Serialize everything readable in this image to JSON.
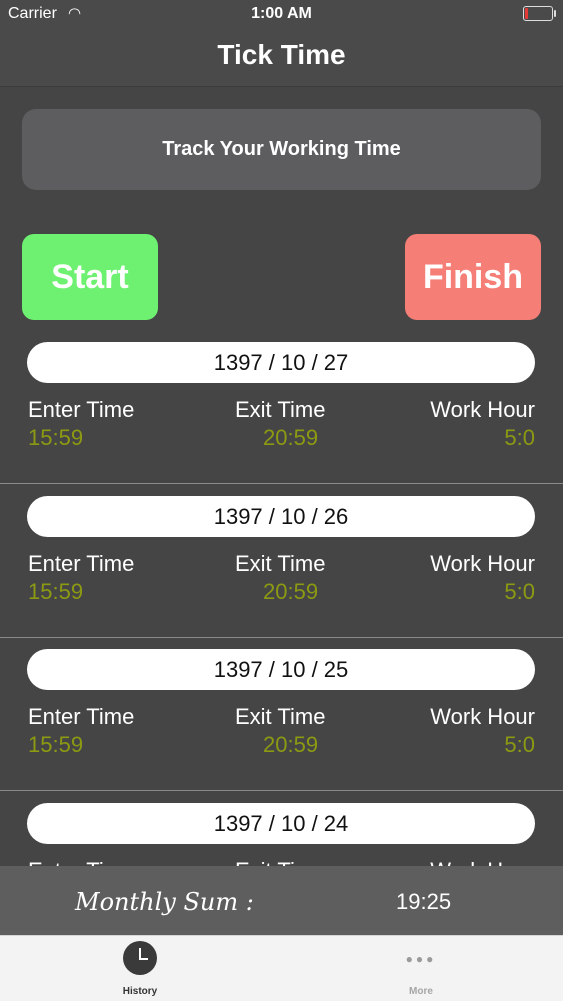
{
  "status_bar": {
    "carrier": "Carrier",
    "time": "1:00 AM",
    "battery_level": 0.12
  },
  "nav": {
    "title": "Tick Time"
  },
  "track_label": "Track Your Working Time",
  "actions": {
    "start_label": "Start",
    "finish_label": "Finish"
  },
  "entries": [
    {
      "date": "1397  / 10 / 27",
      "enter_label": "Enter Time",
      "exit_label": "Exit Time",
      "hour_label": "Work Hour",
      "enter": "15:59",
      "exit": "20:59",
      "hours": "5:0"
    },
    {
      "date": "1397  / 10 / 26",
      "enter_label": "Enter Time",
      "exit_label": "Exit Time",
      "hour_label": "Work Hour",
      "enter": "15:59",
      "exit": "20:59",
      "hours": "5:0"
    },
    {
      "date": "1397  / 10 / 25",
      "enter_label": "Enter Time",
      "exit_label": "Exit Time",
      "hour_label": "Work Hour",
      "enter": "15:59",
      "exit": "20:59",
      "hours": "5:0"
    },
    {
      "date": "1397  / 10 / 24",
      "enter_label": "Enter Time",
      "exit_label": "Exit Time",
      "hour_label": "Work Hour"
    }
  ],
  "monthly": {
    "label": "Monthly Sum :",
    "value": "19:25"
  },
  "tabs": [
    {
      "label": "History",
      "icon": "clock-icon"
    },
    {
      "label": "More",
      "icon": "more-dots-icon"
    }
  ],
  "colors": {
    "start": "#6ef170",
    "finish": "#f57f77",
    "time_value": "#8c9a12",
    "background": "#454545"
  }
}
